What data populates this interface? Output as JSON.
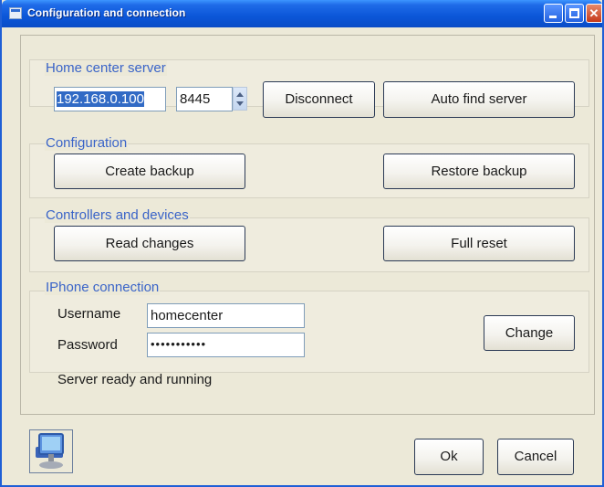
{
  "window": {
    "title": "Configuration and connection"
  },
  "home_center": {
    "label": "Home center server",
    "ip": "192.168.0.100",
    "port": "8445",
    "disconnect_label": "Disconnect",
    "auto_find_label": "Auto find server"
  },
  "configuration": {
    "label": "Configuration",
    "create_backup_label": "Create backup",
    "restore_backup_label": "Restore backup"
  },
  "controllers": {
    "label": "Controllers and devices",
    "read_changes_label": "Read changes",
    "full_reset_label": "Full reset"
  },
  "iphone": {
    "label": "IPhone connection",
    "username_label": "Username",
    "username_value": "homecenter",
    "password_label": "Password",
    "password_value": "•••••••••••",
    "change_label": "Change"
  },
  "status_text": "Server ready and running",
  "footer": {
    "ok_label": "Ok",
    "cancel_label": "Cancel"
  },
  "icons": {
    "window": "app-window-icon",
    "app": "computer-monitor-icon"
  }
}
